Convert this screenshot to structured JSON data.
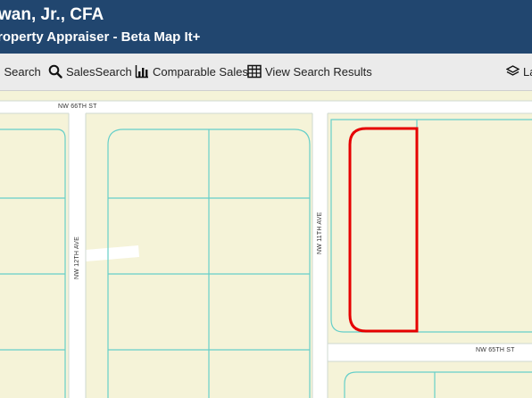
{
  "header": {
    "title": "wan, Jr., CFA",
    "subtitle": "roperty Appraiser - Beta Map It+"
  },
  "toolbar": {
    "address_search_label": "l Search",
    "sales_search_label": "SalesSearch",
    "comparable_sales_label": "Comparable Sales",
    "view_search_results_label": "View Search Results",
    "layers_label": "La"
  },
  "map": {
    "streets": {
      "nw_66th_st": "NW 66TH ST",
      "nw_65th_st": "NW 65TH ST",
      "nw_12th_ave": "NW 12TH AVE",
      "nw_11th_ave": "NW 11TH AVE"
    },
    "colors": {
      "parcel_fill": "#f5f3d8",
      "parcel_line": "#66cfc9",
      "road": "#ffffff",
      "selection": "#e60000",
      "header_bg": "#21466f",
      "toolbar_bg": "#ebebeb"
    }
  }
}
